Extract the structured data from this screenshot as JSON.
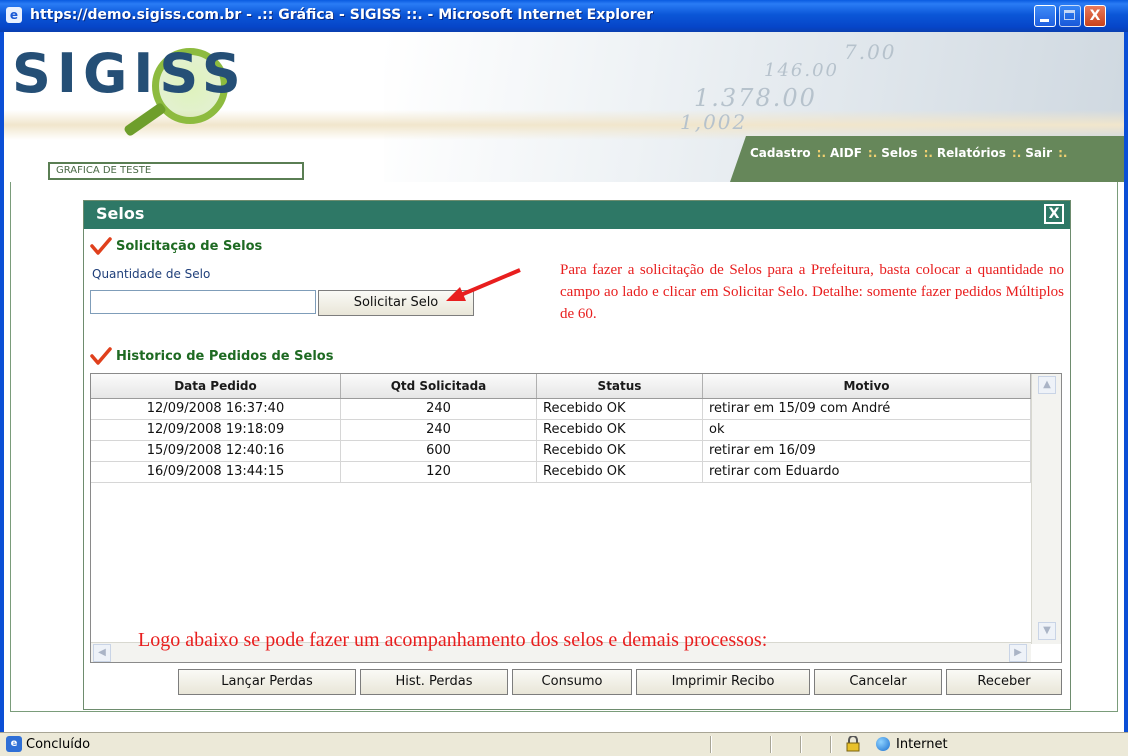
{
  "window": {
    "title": "https://demo.sigiss.com.br - .:: Gráfica - SIGISS ::. - Microsoft Internet Explorer",
    "close_glyph": "X"
  },
  "header": {
    "logo_text": "SIGISS",
    "company": "GRAFICA DE TESTE",
    "background_numbers": [
      "1.378.00",
      "146.00",
      "7.00",
      "1,002"
    ],
    "menu": [
      {
        "label": "Cadastro"
      },
      {
        "label": "AIDF"
      },
      {
        "label": "Selos"
      },
      {
        "label": "Relatórios"
      },
      {
        "label": "Sair"
      }
    ],
    "menu_separator": ":."
  },
  "dialog": {
    "title": "Selos",
    "close_glyph": "X",
    "request_section": {
      "title": "Solicitação de Selos",
      "quantity_label": "Quantidade de Selo",
      "quantity_value": "",
      "submit_label": "Solicitar Selo"
    },
    "annotation": "Para fazer a solicitação de Selos para a Prefeitura, basta colocar a quantidade no campo ao lado e clicar em Solicitar Selo. Detalhe: somente fazer pedidos Múltiplos de 60.",
    "history_section": {
      "title": "Historico de Pedidos de Selos",
      "columns": [
        "Data Pedido",
        "Qtd Solicitada",
        "Status",
        "Motivo"
      ],
      "rows": [
        [
          "12/09/2008 16:37:40",
          "240",
          "Recebido OK",
          "retirar em 15/09 com André"
        ],
        [
          "12/09/2008 19:18:09",
          "240",
          "Recebido OK",
          "ok"
        ],
        [
          "15/09/2008 12:40:16",
          "600",
          "Recebido OK",
          "retirar em 16/09"
        ],
        [
          "16/09/2008 13:44:15",
          "120",
          "Recebido OK",
          "retirar com Eduardo"
        ]
      ],
      "note": "Logo abaixo se pode fazer um acompanhamento dos selos e demais processos:"
    },
    "actions": [
      "Lançar Perdas",
      "Hist. Perdas",
      "Consumo",
      "Imprimir Recibo",
      "Cancelar",
      "Receber"
    ]
  },
  "statusbar": {
    "text": "Concluído",
    "zone": "Internet"
  },
  "colors": {
    "titlebar": "#0b57d8",
    "dialog_header": "#2e7866",
    "section_title": "#1e6a22",
    "menu_tab": "#66875a",
    "annotation": "#e81e1e"
  },
  "icons": [
    "ie-page-icon",
    "minimize-icon",
    "maximize-icon",
    "close-icon",
    "checkmark-icon",
    "arrow-icon",
    "lock-icon",
    "globe-icon"
  ]
}
